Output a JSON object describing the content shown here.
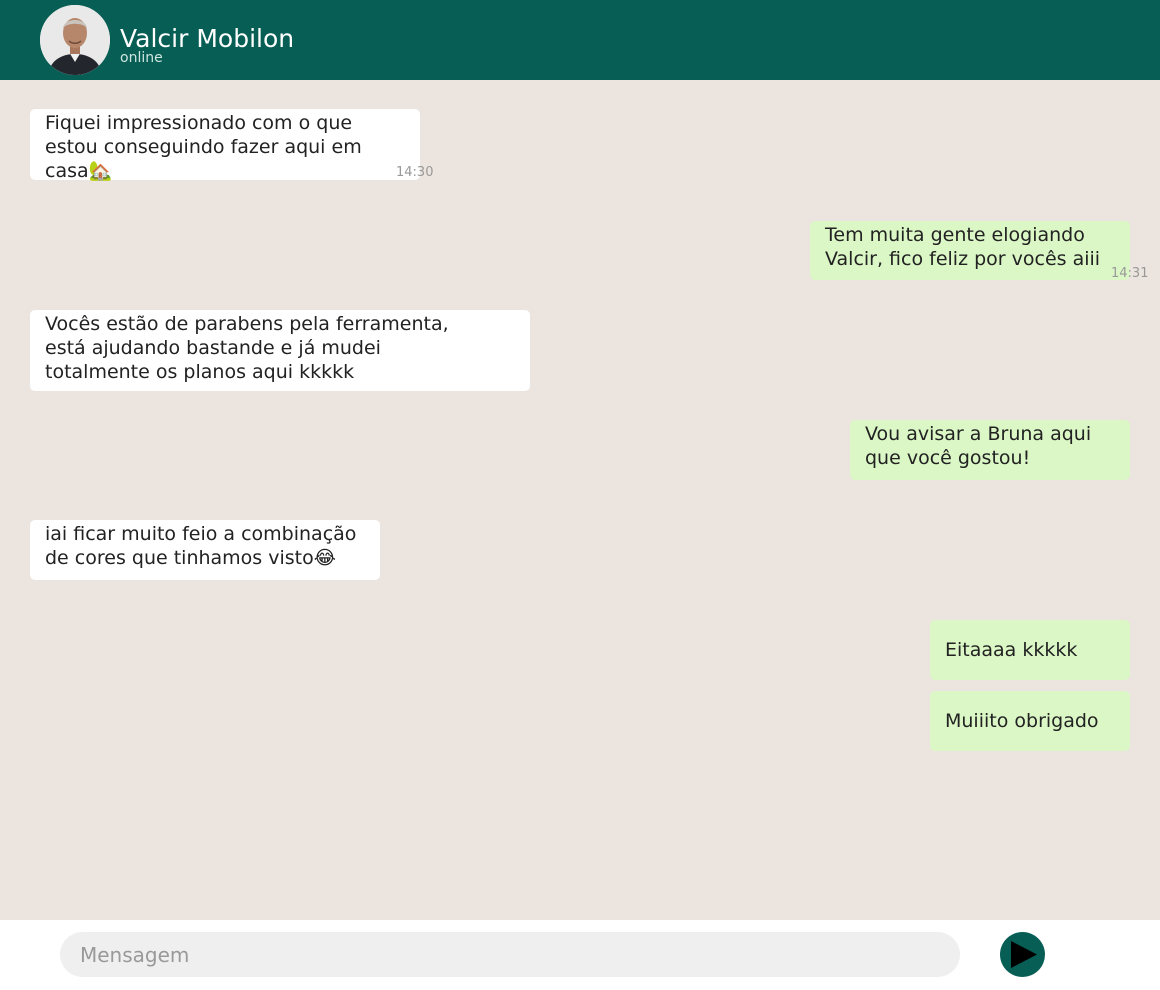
{
  "header": {
    "contact_name": "Valcir Mobilon",
    "status": "online",
    "avatar_icon": "contact-photo-icon",
    "background_color": "#075e55"
  },
  "messages": [
    {
      "direction": "incoming",
      "lines": [
        "Fiquei impressionado com o que",
        "estou conseguindo fazer aqui em",
        "casa🏡"
      ],
      "time": "14:30"
    },
    {
      "direction": "outgoing",
      "lines": [
        "Tem muita gente elogiando",
        "Valcir, fico feliz por vocês aiii"
      ],
      "time": "14:31"
    },
    {
      "direction": "incoming",
      "lines": [
        "Vocês estão de parabens pela ferramenta,",
        "está ajudando bastande e já mudei",
        "totalmente os planos aqui kkkkk"
      ]
    },
    {
      "direction": "outgoing",
      "lines": [
        "Vou avisar a Bruna aqui",
        "que você gostou!"
      ]
    },
    {
      "direction": "incoming",
      "lines": [
        "iai ficar muito feio a combinação",
        "de cores que tinhamos visto😂"
      ]
    },
    {
      "direction": "outgoing",
      "lines": [
        "Eitaaaa kkkkk"
      ]
    },
    {
      "direction": "outgoing",
      "lines": [
        "Muiiito obrigado"
      ]
    }
  ],
  "composer": {
    "placeholder": "Mensagem",
    "value": "",
    "send_icon": "send-icon"
  },
  "colors": {
    "incoming_bubble": "#ffffff",
    "outgoing_bubble": "#dbf7c6",
    "chat_background": "#ece5df",
    "accent": "#075e55"
  }
}
